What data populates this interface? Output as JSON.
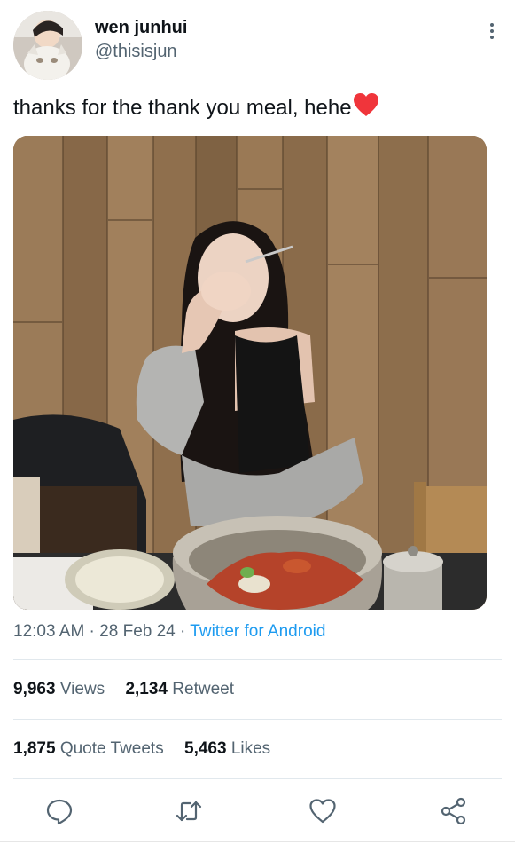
{
  "author": {
    "display_name": "wen junhui",
    "handle": "@thisisjun",
    "avatar_icon": "cat-portrait-avatar"
  },
  "tweet": {
    "text": "thanks for the thank you meal, hehe",
    "emoji": "red-heart-emoji",
    "media_description_icon": "photo-woman-laughing-at-restaurant"
  },
  "meta": {
    "time": "12:03 AM",
    "separator1": " · ",
    "date": "28 Feb 24",
    "separator2": " · ",
    "source": "Twitter for Android"
  },
  "stats": {
    "views_count": "9,963",
    "views_label": "Views",
    "retweets_count": "2,134",
    "retweets_label": "Retweet",
    "quotes_count": "1,875",
    "quotes_label": "Quote Tweets",
    "likes_count": "5,463",
    "likes_label": "Likes"
  },
  "actions": [
    "reply-icon",
    "retweet-icon",
    "like-icon",
    "share-icon"
  ],
  "colors": {
    "accent": "#1d9bf0",
    "secondary_text": "#536471",
    "primary_text": "#0f1419",
    "heart": "#f0353b"
  }
}
